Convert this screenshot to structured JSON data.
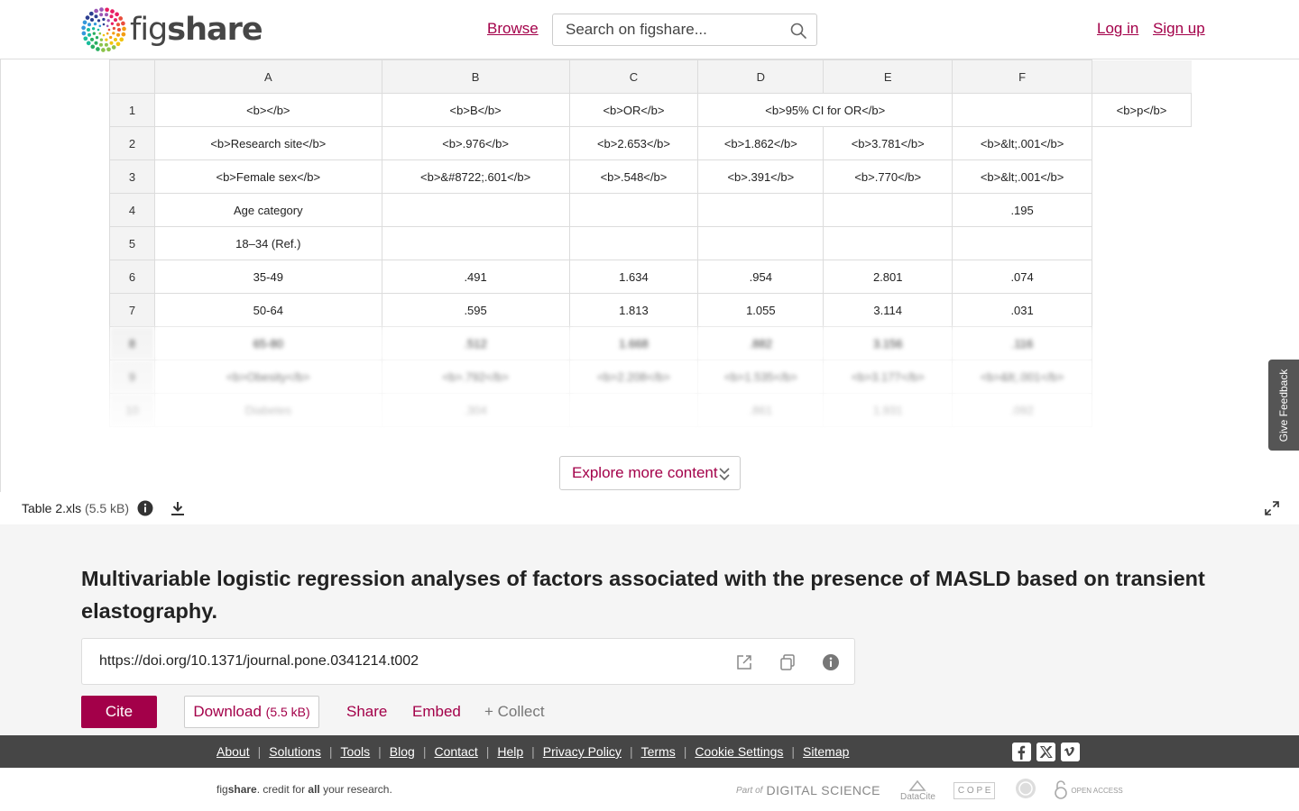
{
  "header": {
    "logo": {
      "fig": "fig",
      "share": "share"
    },
    "browse": "Browse",
    "search_placeholder": "Search on figshare...",
    "login": "Log in",
    "signup": "Sign up"
  },
  "spreadsheet": {
    "column_headers": [
      "A",
      "B",
      "C",
      "D",
      "E",
      "F"
    ],
    "rows": [
      {
        "num": "1",
        "cells": [
          "<b></b>",
          "<b>B</b>",
          "<b>OR</b>",
          "<b>95% CI for OR</b>",
          "",
          "<b>p</b>"
        ]
      },
      {
        "num": "2",
        "cells": [
          "<b>Research site</b>",
          "<b>.976</b>",
          "<b>2.653</b>",
          "<b>1.862</b>",
          "<b>3.781</b>",
          "<b>&lt;.001</b>"
        ]
      },
      {
        "num": "3",
        "cells": [
          "<b>Female sex</b>",
          "<b>&#8722;.601</b>",
          "<b>.548</b>",
          "<b>.391</b>",
          "<b>.770</b>",
          "<b>&lt;.001</b>"
        ]
      },
      {
        "num": "4",
        "cells": [
          "Age category",
          "",
          "",
          "",
          "",
          ".195"
        ]
      },
      {
        "num": "5",
        "cells": [
          "18–34 (Ref.)",
          "",
          "",
          "",
          "",
          ""
        ]
      },
      {
        "num": "6",
        "cells": [
          "35-49",
          ".491",
          "1.634",
          ".954",
          "2.801",
          ".074"
        ]
      },
      {
        "num": "7",
        "cells": [
          "50-64",
          ".595",
          "1.813",
          "1.055",
          "3.114",
          ".031"
        ]
      },
      {
        "num": "8",
        "cells": [
          "65-80",
          ".512",
          "1.668",
          ".882",
          "3.156",
          ".116"
        ]
      },
      {
        "num": "9",
        "cells": [
          "<b>Obesity</b>",
          "<b>.792</b>",
          "<b>2.208</b>",
          "<b>1.535</b>",
          "<b>3.177</b>",
          "<b>&lt;.001</b>"
        ]
      },
      {
        "num": "10",
        "cells": [
          "Diabetes",
          ".304",
          "",
          ".861",
          "1.931",
          ".092"
        ]
      }
    ]
  },
  "explore_label": "Explore more content",
  "feedback_label": "Give Feedback",
  "file": {
    "name": "Table 2.xls",
    "size": "(5.5 kB)"
  },
  "item": {
    "title": "Multivariable logistic regression analyses of factors associated with the presence of MASLD based on transient elastography.",
    "doi": "https://doi.org/10.1371/journal.pone.0341214.t002"
  },
  "actions": {
    "cite": "Cite",
    "download": "Download",
    "download_size": "(5.5 kB)",
    "share": "Share",
    "embed": "Embed",
    "collect": "+ Collect"
  },
  "footer": {
    "links": [
      "About",
      "Solutions",
      "Tools",
      "Blog",
      "Contact",
      "Help",
      "Privacy Policy",
      "Terms",
      "Cookie Settings",
      "Sitemap"
    ],
    "tagline": {
      "fig": "fig",
      "share": "share",
      "rest1": ". credit for ",
      "all": "all",
      "rest2": " your research."
    },
    "partners": {
      "part_of": "Part of",
      "ds": "DIGITAL SCIENCE",
      "datacite": "DataCite",
      "cope": "C O P E",
      "oa": "OPEN ACCESS"
    }
  },
  "colors": {
    "brand": "#a30049",
    "footer_bg": "#464646"
  }
}
